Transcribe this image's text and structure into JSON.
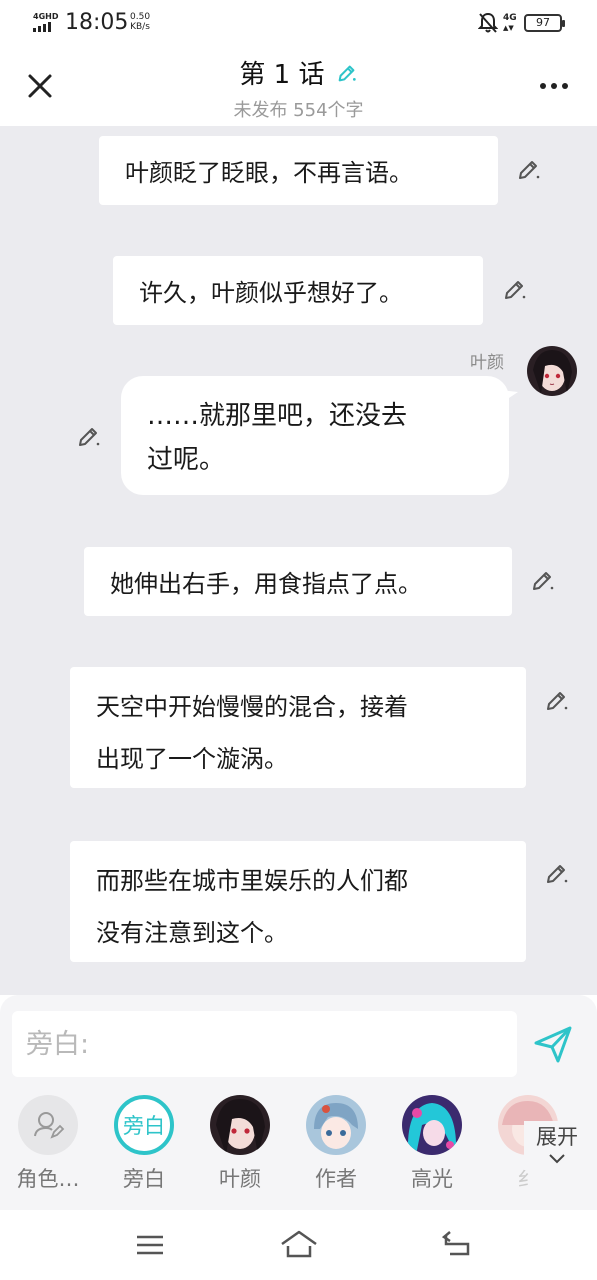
{
  "status_bar": {
    "network": "4GHD",
    "time": "18:05",
    "speed_value": "0.50",
    "speed_unit": "KB/s",
    "network2": "4G",
    "battery": "97"
  },
  "header": {
    "title": "第 1 话",
    "subtitle": "未发布 554个字",
    "accent_color": "#2ec4c9"
  },
  "messages": [
    {
      "type": "narration",
      "text": "叶颜眨了眨眼，不再言语。"
    },
    {
      "type": "narration",
      "text": "许久，叶颜似乎想好了。"
    },
    {
      "type": "dialog",
      "speaker": "叶颜",
      "lines": [
        "……就那里吧，还没去",
        "过呢。"
      ]
    },
    {
      "type": "narration",
      "text": "她伸出右手，用食指点了点。"
    },
    {
      "type": "narration",
      "lines": [
        "天空中开始慢慢的混合，接着",
        "出现了一个漩涡。"
      ]
    },
    {
      "type": "narration",
      "lines": [
        "而那些在城市里娱乐的人们都",
        "没有注意到这个。"
      ]
    }
  ],
  "composer": {
    "placeholder": "旁白:"
  },
  "roles": [
    {
      "label": "角色…",
      "icon": "person-edit-icon"
    },
    {
      "label": "旁白",
      "badge": "旁白",
      "selected": true
    },
    {
      "label": "叶颜"
    },
    {
      "label": "作者"
    },
    {
      "label": "高光"
    },
    {
      "label": "纟"
    }
  ],
  "expand_label": "展开"
}
